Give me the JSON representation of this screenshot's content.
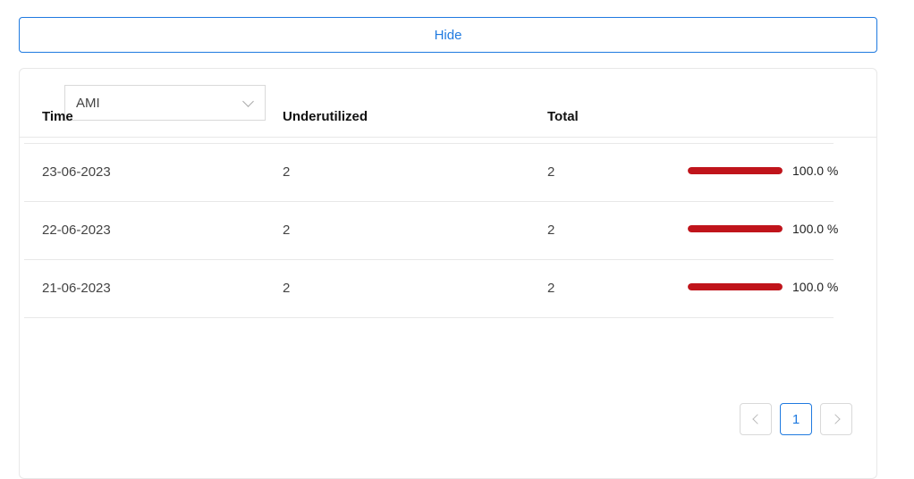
{
  "hide_button": {
    "label": "Hide"
  },
  "filter": {
    "selected": "AMI"
  },
  "table": {
    "headers": {
      "time": "Time",
      "underutilized": "Underutilized",
      "total": "Total"
    },
    "rows": [
      {
        "time": "23-06-2023",
        "underutilized": "2",
        "total": "2",
        "percent": 100,
        "percent_label": "100.0 %"
      },
      {
        "time": "22-06-2023",
        "underutilized": "2",
        "total": "2",
        "percent": 100,
        "percent_label": "100.0 %"
      },
      {
        "time": "21-06-2023",
        "underutilized": "2",
        "total": "2",
        "percent": 100,
        "percent_label": "100.0 %"
      }
    ]
  },
  "pagination": {
    "current_page": "1"
  },
  "colors": {
    "accent": "#1f7ae0",
    "progress": "#c0141b"
  }
}
